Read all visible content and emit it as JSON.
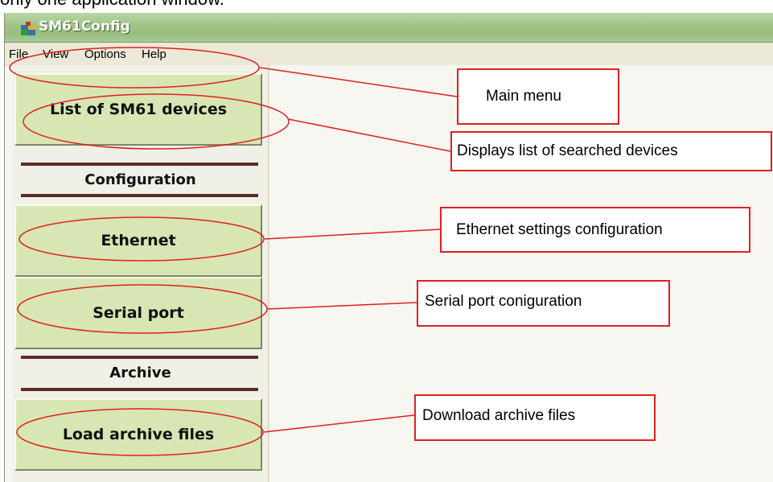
{
  "caption": "only one application window.",
  "window": {
    "title": "SM61Config"
  },
  "menu": {
    "items": [
      "File",
      "View",
      "Options",
      "Help"
    ]
  },
  "sidebar": {
    "list_button": "List of SM61 devices",
    "section_configuration": "Configuration",
    "ethernet_button": "Ethernet",
    "serial_button": "Serial port",
    "section_archive": "Archive",
    "archive_button": "Load archive files"
  },
  "annotations": {
    "main_menu": "Main menu",
    "list_devices": "Displays list of searched devices",
    "ethernet": "Ethernet settings configuration",
    "serial": "Serial port coniguration",
    "archive": "Download archive files"
  },
  "colors": {
    "annotation_red": "#e02020",
    "button_green": "#d7e6b3",
    "titlebar_green": "#a4c78b"
  },
  "icons": {
    "app_icon": "sm61config-app-icon"
  }
}
